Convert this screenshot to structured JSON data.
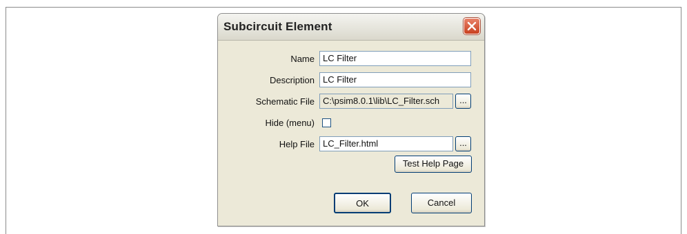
{
  "dialog": {
    "title": "Subcircuit Element",
    "close_icon": "close-x-icon"
  },
  "form": {
    "name": {
      "label": "Name",
      "value": "LC Filter"
    },
    "description": {
      "label": "Description",
      "value": "LC Filter"
    },
    "schematic_file": {
      "label": "Schematic File",
      "value": "C:\\psim8.0.1\\lib\\LC_Filter.sch",
      "browse_label": "..."
    },
    "hide_menu": {
      "label": "Hide (menu)",
      "checked": false
    },
    "help_file": {
      "label": "Help File",
      "value": "LC_Filter.html",
      "browse_label": "..."
    },
    "test_help_label": "Test Help Page"
  },
  "buttons": {
    "ok_label": "OK",
    "cancel_label": "Cancel"
  },
  "colors": {
    "dialog_bg": "#ece9d8",
    "close_button": "#d4583a",
    "field_border": "#7f9db9"
  }
}
